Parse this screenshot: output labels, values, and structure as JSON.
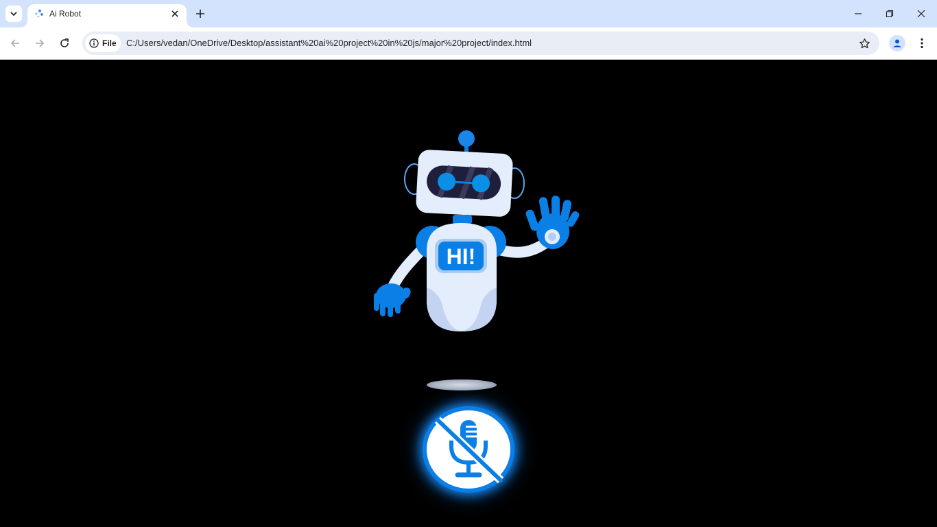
{
  "browser": {
    "tab": {
      "title": "Ai Robot"
    },
    "address": {
      "scheme_label": "File",
      "url": "C:/Users/vedan/OneDrive/Desktop/assistant%20ai%20project%20in%20js/major%20project/index.html"
    },
    "icons": {
      "tab_search": "chevron-down-icon",
      "new_tab": "plus-icon",
      "minimize": "minimize-icon",
      "restore": "restore-icon",
      "close": "close-icon",
      "back": "arrow-left-icon",
      "forward": "arrow-right-icon",
      "reload": "reload-icon",
      "site_info": "info-icon",
      "bookmark": "star-icon",
      "profile": "person-icon",
      "menu": "kebab-menu-icon"
    }
  },
  "page": {
    "robot": {
      "badge_text": "HI!"
    },
    "mic_button": {
      "icon": "microphone-off-icon",
      "state": "muted"
    },
    "colors": {
      "background": "#000000",
      "accent": "#0a7fe6",
      "robot_body": "#e4edfb",
      "robot_shade": "#c3d3f1"
    }
  }
}
